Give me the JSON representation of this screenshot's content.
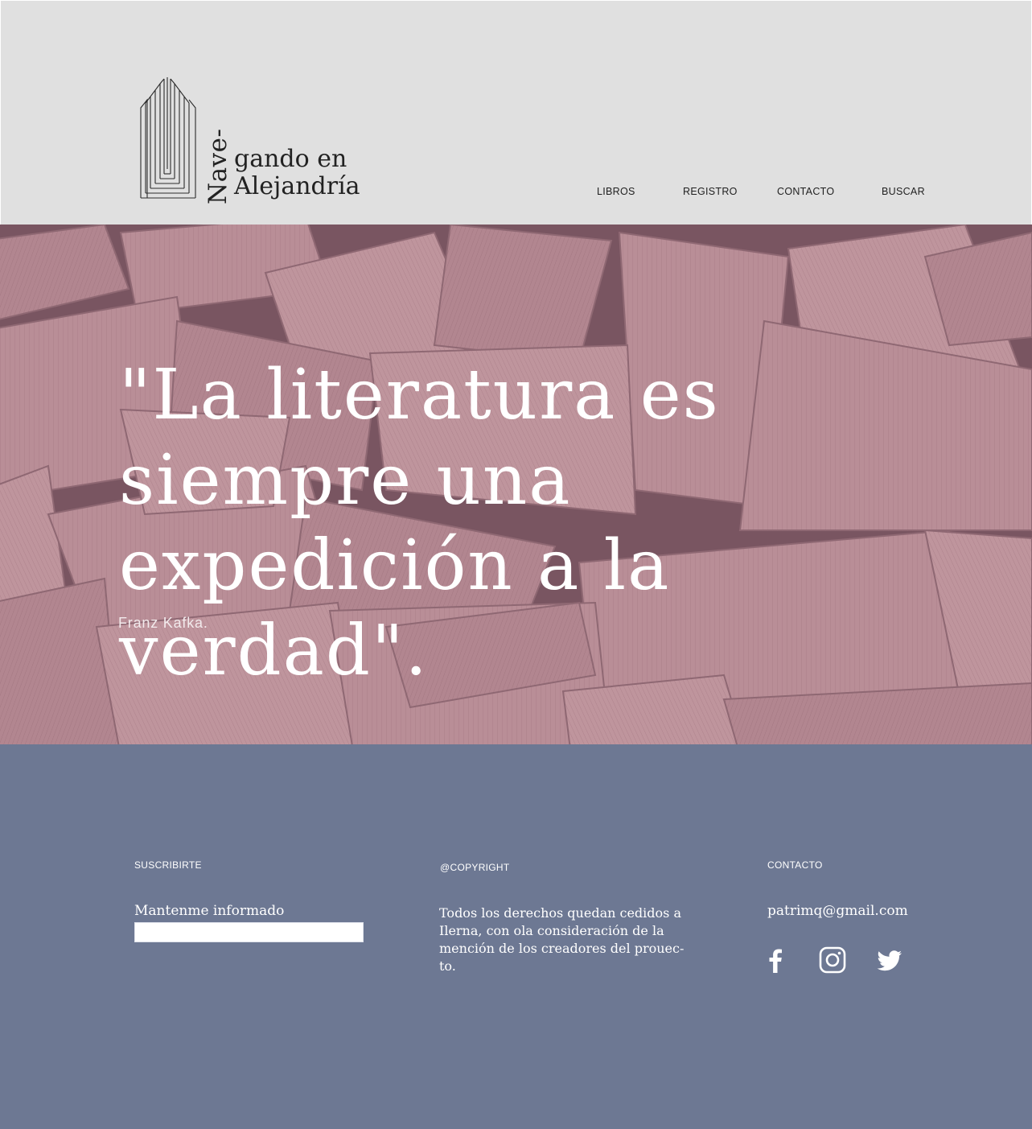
{
  "header": {
    "logo": {
      "vertical_text": "Nave-",
      "line1": "gando en",
      "line2": "Alejandría"
    },
    "nav": [
      {
        "label": "LIBROS"
      },
      {
        "label": "REGISTRO"
      },
      {
        "label": "CONTACTO"
      },
      {
        "label": "BUSCAR"
      }
    ]
  },
  "hero": {
    "quote": "\"La literatura es siempre una expedición a la verdad\".",
    "author": "Franz Kafka."
  },
  "footer": {
    "subscribe": {
      "heading": "SUSCRIBIRTE",
      "label": "Mantenme informado",
      "input_value": ""
    },
    "copyright": {
      "heading": "@COPYRIGHT",
      "text": "Todos los derechos quedan cedidos a Ilerna, con ola consideración de la mención de los creadores del prouec-to."
    },
    "contact": {
      "heading": "CONTACTO",
      "email": "patrimq@gmail.com",
      "social_icons": [
        "facebook-icon",
        "instagram-icon",
        "twitter-icon"
      ]
    }
  },
  "colors": {
    "header_bg": "#e0e0e0",
    "hero_tint": "#9a7a84",
    "footer_bg": "#6d7893",
    "text_dark": "#1f1f1f",
    "text_light": "#ffffff"
  }
}
